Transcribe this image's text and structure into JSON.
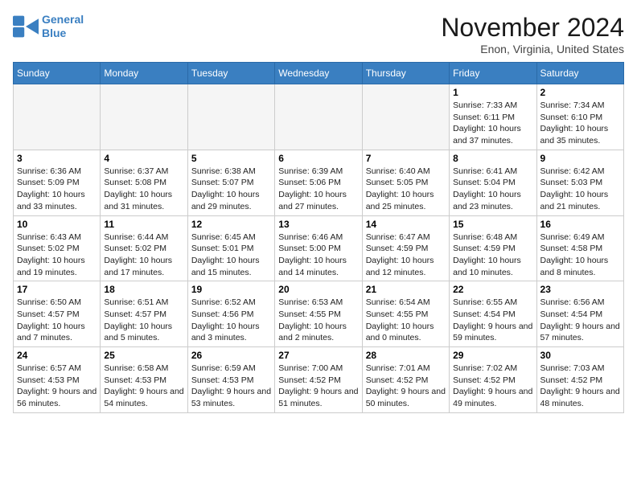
{
  "logo": {
    "line1": "General",
    "line2": "Blue"
  },
  "title": "November 2024",
  "location": "Enon, Virginia, United States",
  "days_of_week": [
    "Sunday",
    "Monday",
    "Tuesday",
    "Wednesday",
    "Thursday",
    "Friday",
    "Saturday"
  ],
  "weeks": [
    [
      {
        "day": "",
        "info": ""
      },
      {
        "day": "",
        "info": ""
      },
      {
        "day": "",
        "info": ""
      },
      {
        "day": "",
        "info": ""
      },
      {
        "day": "",
        "info": ""
      },
      {
        "day": "1",
        "info": "Sunrise: 7:33 AM\nSunset: 6:11 PM\nDaylight: 10 hours and 37 minutes."
      },
      {
        "day": "2",
        "info": "Sunrise: 7:34 AM\nSunset: 6:10 PM\nDaylight: 10 hours and 35 minutes."
      }
    ],
    [
      {
        "day": "3",
        "info": "Sunrise: 6:36 AM\nSunset: 5:09 PM\nDaylight: 10 hours and 33 minutes."
      },
      {
        "day": "4",
        "info": "Sunrise: 6:37 AM\nSunset: 5:08 PM\nDaylight: 10 hours and 31 minutes."
      },
      {
        "day": "5",
        "info": "Sunrise: 6:38 AM\nSunset: 5:07 PM\nDaylight: 10 hours and 29 minutes."
      },
      {
        "day": "6",
        "info": "Sunrise: 6:39 AM\nSunset: 5:06 PM\nDaylight: 10 hours and 27 minutes."
      },
      {
        "day": "7",
        "info": "Sunrise: 6:40 AM\nSunset: 5:05 PM\nDaylight: 10 hours and 25 minutes."
      },
      {
        "day": "8",
        "info": "Sunrise: 6:41 AM\nSunset: 5:04 PM\nDaylight: 10 hours and 23 minutes."
      },
      {
        "day": "9",
        "info": "Sunrise: 6:42 AM\nSunset: 5:03 PM\nDaylight: 10 hours and 21 minutes."
      }
    ],
    [
      {
        "day": "10",
        "info": "Sunrise: 6:43 AM\nSunset: 5:02 PM\nDaylight: 10 hours and 19 minutes."
      },
      {
        "day": "11",
        "info": "Sunrise: 6:44 AM\nSunset: 5:02 PM\nDaylight: 10 hours and 17 minutes."
      },
      {
        "day": "12",
        "info": "Sunrise: 6:45 AM\nSunset: 5:01 PM\nDaylight: 10 hours and 15 minutes."
      },
      {
        "day": "13",
        "info": "Sunrise: 6:46 AM\nSunset: 5:00 PM\nDaylight: 10 hours and 14 minutes."
      },
      {
        "day": "14",
        "info": "Sunrise: 6:47 AM\nSunset: 4:59 PM\nDaylight: 10 hours and 12 minutes."
      },
      {
        "day": "15",
        "info": "Sunrise: 6:48 AM\nSunset: 4:59 PM\nDaylight: 10 hours and 10 minutes."
      },
      {
        "day": "16",
        "info": "Sunrise: 6:49 AM\nSunset: 4:58 PM\nDaylight: 10 hours and 8 minutes."
      }
    ],
    [
      {
        "day": "17",
        "info": "Sunrise: 6:50 AM\nSunset: 4:57 PM\nDaylight: 10 hours and 7 minutes."
      },
      {
        "day": "18",
        "info": "Sunrise: 6:51 AM\nSunset: 4:57 PM\nDaylight: 10 hours and 5 minutes."
      },
      {
        "day": "19",
        "info": "Sunrise: 6:52 AM\nSunset: 4:56 PM\nDaylight: 10 hours and 3 minutes."
      },
      {
        "day": "20",
        "info": "Sunrise: 6:53 AM\nSunset: 4:55 PM\nDaylight: 10 hours and 2 minutes."
      },
      {
        "day": "21",
        "info": "Sunrise: 6:54 AM\nSunset: 4:55 PM\nDaylight: 10 hours and 0 minutes."
      },
      {
        "day": "22",
        "info": "Sunrise: 6:55 AM\nSunset: 4:54 PM\nDaylight: 9 hours and 59 minutes."
      },
      {
        "day": "23",
        "info": "Sunrise: 6:56 AM\nSunset: 4:54 PM\nDaylight: 9 hours and 57 minutes."
      }
    ],
    [
      {
        "day": "24",
        "info": "Sunrise: 6:57 AM\nSunset: 4:53 PM\nDaylight: 9 hours and 56 minutes."
      },
      {
        "day": "25",
        "info": "Sunrise: 6:58 AM\nSunset: 4:53 PM\nDaylight: 9 hours and 54 minutes."
      },
      {
        "day": "26",
        "info": "Sunrise: 6:59 AM\nSunset: 4:53 PM\nDaylight: 9 hours and 53 minutes."
      },
      {
        "day": "27",
        "info": "Sunrise: 7:00 AM\nSunset: 4:52 PM\nDaylight: 9 hours and 51 minutes."
      },
      {
        "day": "28",
        "info": "Sunrise: 7:01 AM\nSunset: 4:52 PM\nDaylight: 9 hours and 50 minutes."
      },
      {
        "day": "29",
        "info": "Sunrise: 7:02 AM\nSunset: 4:52 PM\nDaylight: 9 hours and 49 minutes."
      },
      {
        "day": "30",
        "info": "Sunrise: 7:03 AM\nSunset: 4:52 PM\nDaylight: 9 hours and 48 minutes."
      }
    ]
  ]
}
